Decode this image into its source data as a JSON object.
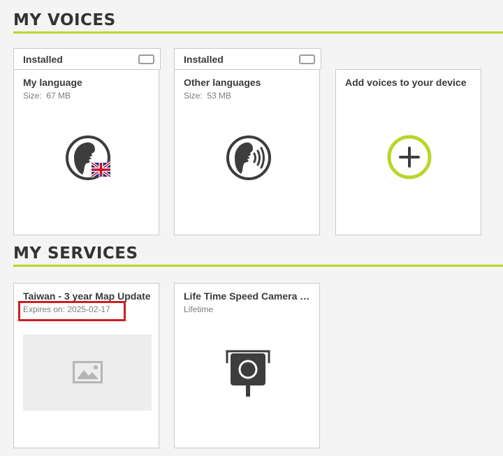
{
  "voices": {
    "title": "MY VOICES",
    "cards": [
      {
        "status": "Installed",
        "title": "My language",
        "size_label": "Size:",
        "size_value": "67 MB",
        "icon": "speaking-head-uk-flag-icon"
      },
      {
        "status": "Installed",
        "title": "Other languages",
        "size_label": "Size:",
        "size_value": "53 MB",
        "icon": "speaking-head-sound-icon"
      },
      {
        "title": "Add voices to your device",
        "icon": "add-circle-icon"
      }
    ]
  },
  "services": {
    "title": "MY SERVICES",
    "cards": [
      {
        "title": "Taiwan - 3 year Map Update",
        "subtitle": "Expires on: 2025-02-17",
        "icon": "image-placeholder-icon"
      },
      {
        "title": "Life Time Speed Camera Update",
        "subtitle": "Lifetime",
        "icon": "speed-camera-icon"
      }
    ]
  },
  "colors": {
    "accent": "#bcd42a",
    "highlight": "#cc1f1f",
    "icon_dark": "#3d3d3d"
  }
}
